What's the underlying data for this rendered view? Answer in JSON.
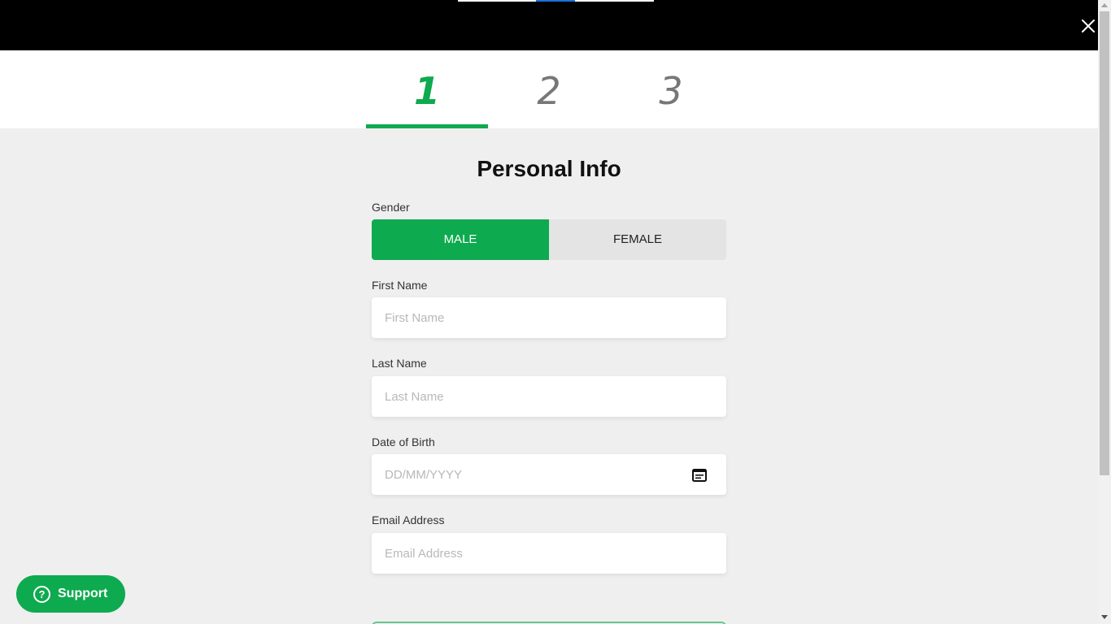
{
  "header": {
    "close_icon": "close-icon"
  },
  "steps": [
    {
      "label": "1",
      "active": true
    },
    {
      "label": "2",
      "active": false
    },
    {
      "label": "3",
      "active": false
    }
  ],
  "form": {
    "title": "Personal Info",
    "gender": {
      "label": "Gender",
      "options": [
        "MALE",
        "FEMALE"
      ],
      "selected": "MALE"
    },
    "first_name": {
      "label": "First Name",
      "placeholder": "First Name",
      "value": ""
    },
    "last_name": {
      "label": "Last Name",
      "placeholder": "Last Name",
      "value": ""
    },
    "dob": {
      "label": "Date of Birth",
      "placeholder": "DD/MM/YYYY",
      "value": "",
      "icon": "calendar-icon"
    },
    "email": {
      "label": "Email Address",
      "placeholder": "Email Address",
      "value": ""
    }
  },
  "support": {
    "label": "Support",
    "icon": "help-circle-icon",
    "icon_glyph": "?"
  },
  "colors": {
    "accent": "#0eaa4f",
    "header_bg": "#000000",
    "page_bg": "#efefef"
  }
}
